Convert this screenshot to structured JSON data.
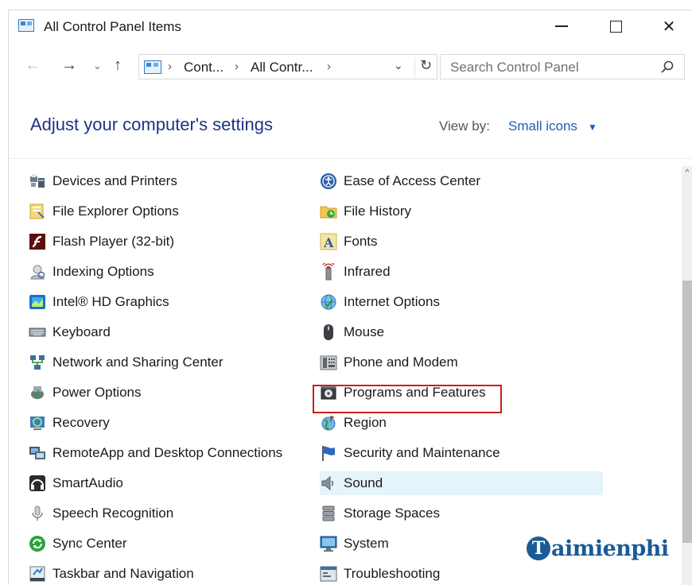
{
  "window": {
    "title": "All Control Panel Items",
    "minimize_glyph": "",
    "close_glyph": "✕"
  },
  "nav": {
    "back_glyph": "←",
    "forward_glyph": "→",
    "recent_glyph": "⌄",
    "up_glyph": "↑",
    "breadcrumbs": [
      "Cont...",
      "All Contr..."
    ],
    "breadcrumb_separator": "›",
    "dropdown_glyph": "⌄",
    "refresh_glyph": "↻",
    "search_placeholder": "Search Control Panel"
  },
  "header": {
    "title": "Adjust your computer's settings",
    "view_by_label": "View by:",
    "view_by_value": "Small icons",
    "view_by_caret": "▼"
  },
  "items_left": [
    {
      "label": "Devices and Printers",
      "icon": "printer-icon"
    },
    {
      "label": "File Explorer Options",
      "icon": "folder-options-icon"
    },
    {
      "label": "Flash Player (32-bit)",
      "icon": "flash-icon"
    },
    {
      "label": "Indexing Options",
      "icon": "indexing-icon"
    },
    {
      "label": "Intel® HD Graphics",
      "icon": "intel-graphics-icon"
    },
    {
      "label": "Keyboard",
      "icon": "keyboard-icon"
    },
    {
      "label": "Network and Sharing Center",
      "icon": "network-icon"
    },
    {
      "label": "Power Options",
      "icon": "power-icon"
    },
    {
      "label": "Recovery",
      "icon": "recovery-icon"
    },
    {
      "label": "RemoteApp and Desktop Connections",
      "icon": "remoteapp-icon"
    },
    {
      "label": "SmartAudio",
      "icon": "smartaudio-icon"
    },
    {
      "label": "Speech Recognition",
      "icon": "microphone-icon"
    },
    {
      "label": "Sync Center",
      "icon": "sync-icon"
    },
    {
      "label": "Taskbar and Navigation",
      "icon": "taskbar-icon"
    }
  ],
  "items_right": [
    {
      "label": "Ease of Access Center",
      "icon": "ease-of-access-icon"
    },
    {
      "label": "File History",
      "icon": "file-history-icon"
    },
    {
      "label": "Fonts",
      "icon": "fonts-icon"
    },
    {
      "label": "Infrared",
      "icon": "infrared-icon"
    },
    {
      "label": "Internet Options",
      "icon": "internet-options-icon"
    },
    {
      "label": "Mouse",
      "icon": "mouse-icon"
    },
    {
      "label": "Phone and Modem",
      "icon": "phone-modem-icon"
    },
    {
      "label": "Programs and Features",
      "icon": "programs-features-icon"
    },
    {
      "label": "Region",
      "icon": "region-icon"
    },
    {
      "label": "Security and Maintenance",
      "icon": "flag-icon"
    },
    {
      "label": "Sound",
      "icon": "speaker-icon"
    },
    {
      "label": "Storage Spaces",
      "icon": "storage-icon"
    },
    {
      "label": "System",
      "icon": "system-icon"
    },
    {
      "label": "Troubleshooting",
      "icon": "troubleshooting-icon"
    }
  ],
  "highlighted_item": "Programs and Features",
  "hovered_item": "Sound",
  "scrollbar": {
    "up_glyph": "^"
  },
  "watermark": {
    "logo_letter": "T",
    "text": "aimienphi"
  },
  "colors": {
    "heading": "#1e3287",
    "link": "#1a5fb4",
    "highlight_border": "#c8201a",
    "hover_bg": "#e5f3fb",
    "watermark": "#1a5a97"
  }
}
